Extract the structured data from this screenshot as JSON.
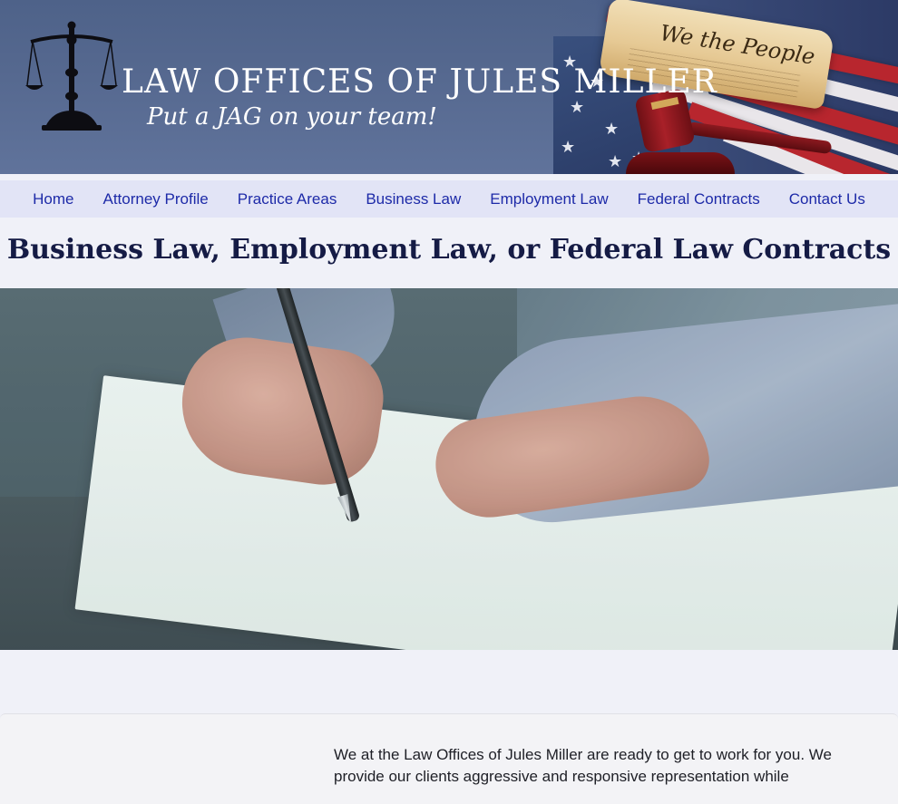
{
  "header": {
    "brand_title_main": "LAW OFFICES OF JULES MILLER",
    "tagline": "Put a JAG on your team!",
    "parchment_text": "We the People"
  },
  "nav": {
    "items": [
      {
        "label": "Home"
      },
      {
        "label": "Attorney Profile"
      },
      {
        "label": "Practice Areas"
      },
      {
        "label": "Business Law"
      },
      {
        "label": "Employment Law"
      },
      {
        "label": "Federal Contracts"
      },
      {
        "label": "Contact Us"
      }
    ]
  },
  "main": {
    "page_title": "Business Law, Employment Law, or Federal Law Contracts",
    "intro_text": "We at the Law Offices of Jules Miller are ready to get to work for you. We provide our clients aggressive and responsive representation while"
  },
  "colors": {
    "banner": "#55688f",
    "nav_bg": "#e2e4f6",
    "nav_link": "#1d2aa8",
    "title": "#151b45",
    "page_bg": "#f0f1f8"
  },
  "icons": {
    "logo": "scales-of-justice-icon"
  }
}
